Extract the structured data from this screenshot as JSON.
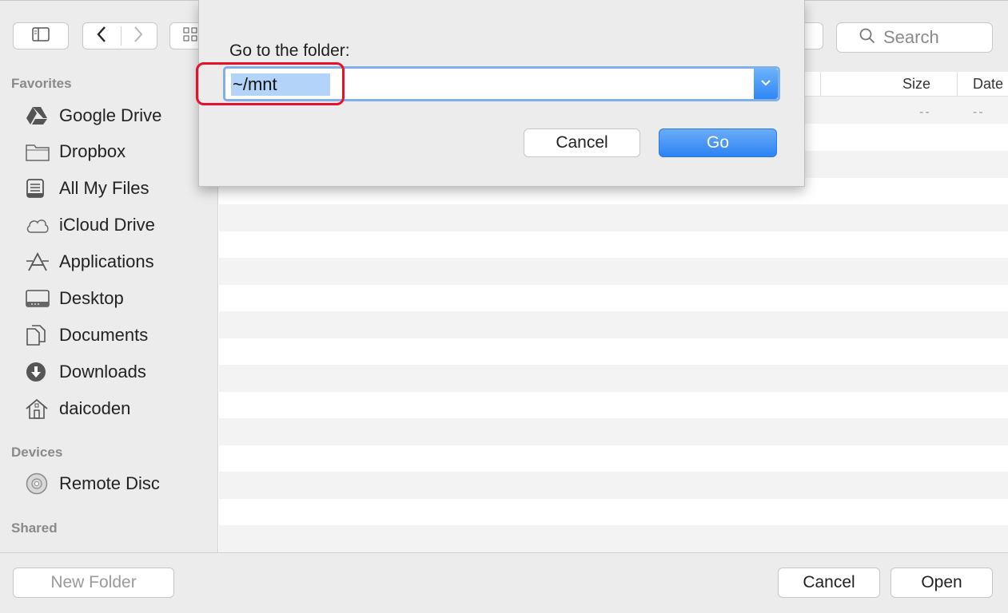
{
  "toolbar": {
    "back_icon": "chevron-left-icon",
    "forward_icon": "chevron-right-icon",
    "sidebar_toggle_icon": "sidebar-toggle-icon",
    "view_icon": "icon-view-grid",
    "search_placeholder": "Search"
  },
  "sidebar": {
    "favorites_heading": "Favorites",
    "favorites": [
      {
        "label": "Google Drive",
        "icon": "google-drive-icon"
      },
      {
        "label": "Dropbox",
        "icon": "folder-icon"
      },
      {
        "label": "All My Files",
        "icon": "all-files-icon"
      },
      {
        "label": "iCloud Drive",
        "icon": "cloud-icon"
      },
      {
        "label": "Applications",
        "icon": "applications-icon"
      },
      {
        "label": "Desktop",
        "icon": "desktop-icon"
      },
      {
        "label": "Documents",
        "icon": "documents-icon"
      },
      {
        "label": "Downloads",
        "icon": "downloads-icon"
      },
      {
        "label": "daicoden",
        "icon": "home-icon"
      }
    ],
    "devices_heading": "Devices",
    "devices": [
      {
        "label": "Remote Disc",
        "icon": "disc-icon"
      }
    ],
    "shared_heading": "Shared"
  },
  "file_list": {
    "columns": {
      "size": "Size",
      "date": "Date"
    },
    "rows": [
      {
        "size": "--",
        "date": "--"
      }
    ]
  },
  "bottom_bar": {
    "new_folder": "New Folder",
    "cancel": "Cancel",
    "open": "Open"
  },
  "goto_dialog": {
    "title": "Go to the folder:",
    "path_value": "~/mnt",
    "cancel": "Cancel",
    "go": "Go",
    "highlight_color": "#e8112b",
    "accent_color": "#2d83f4"
  }
}
